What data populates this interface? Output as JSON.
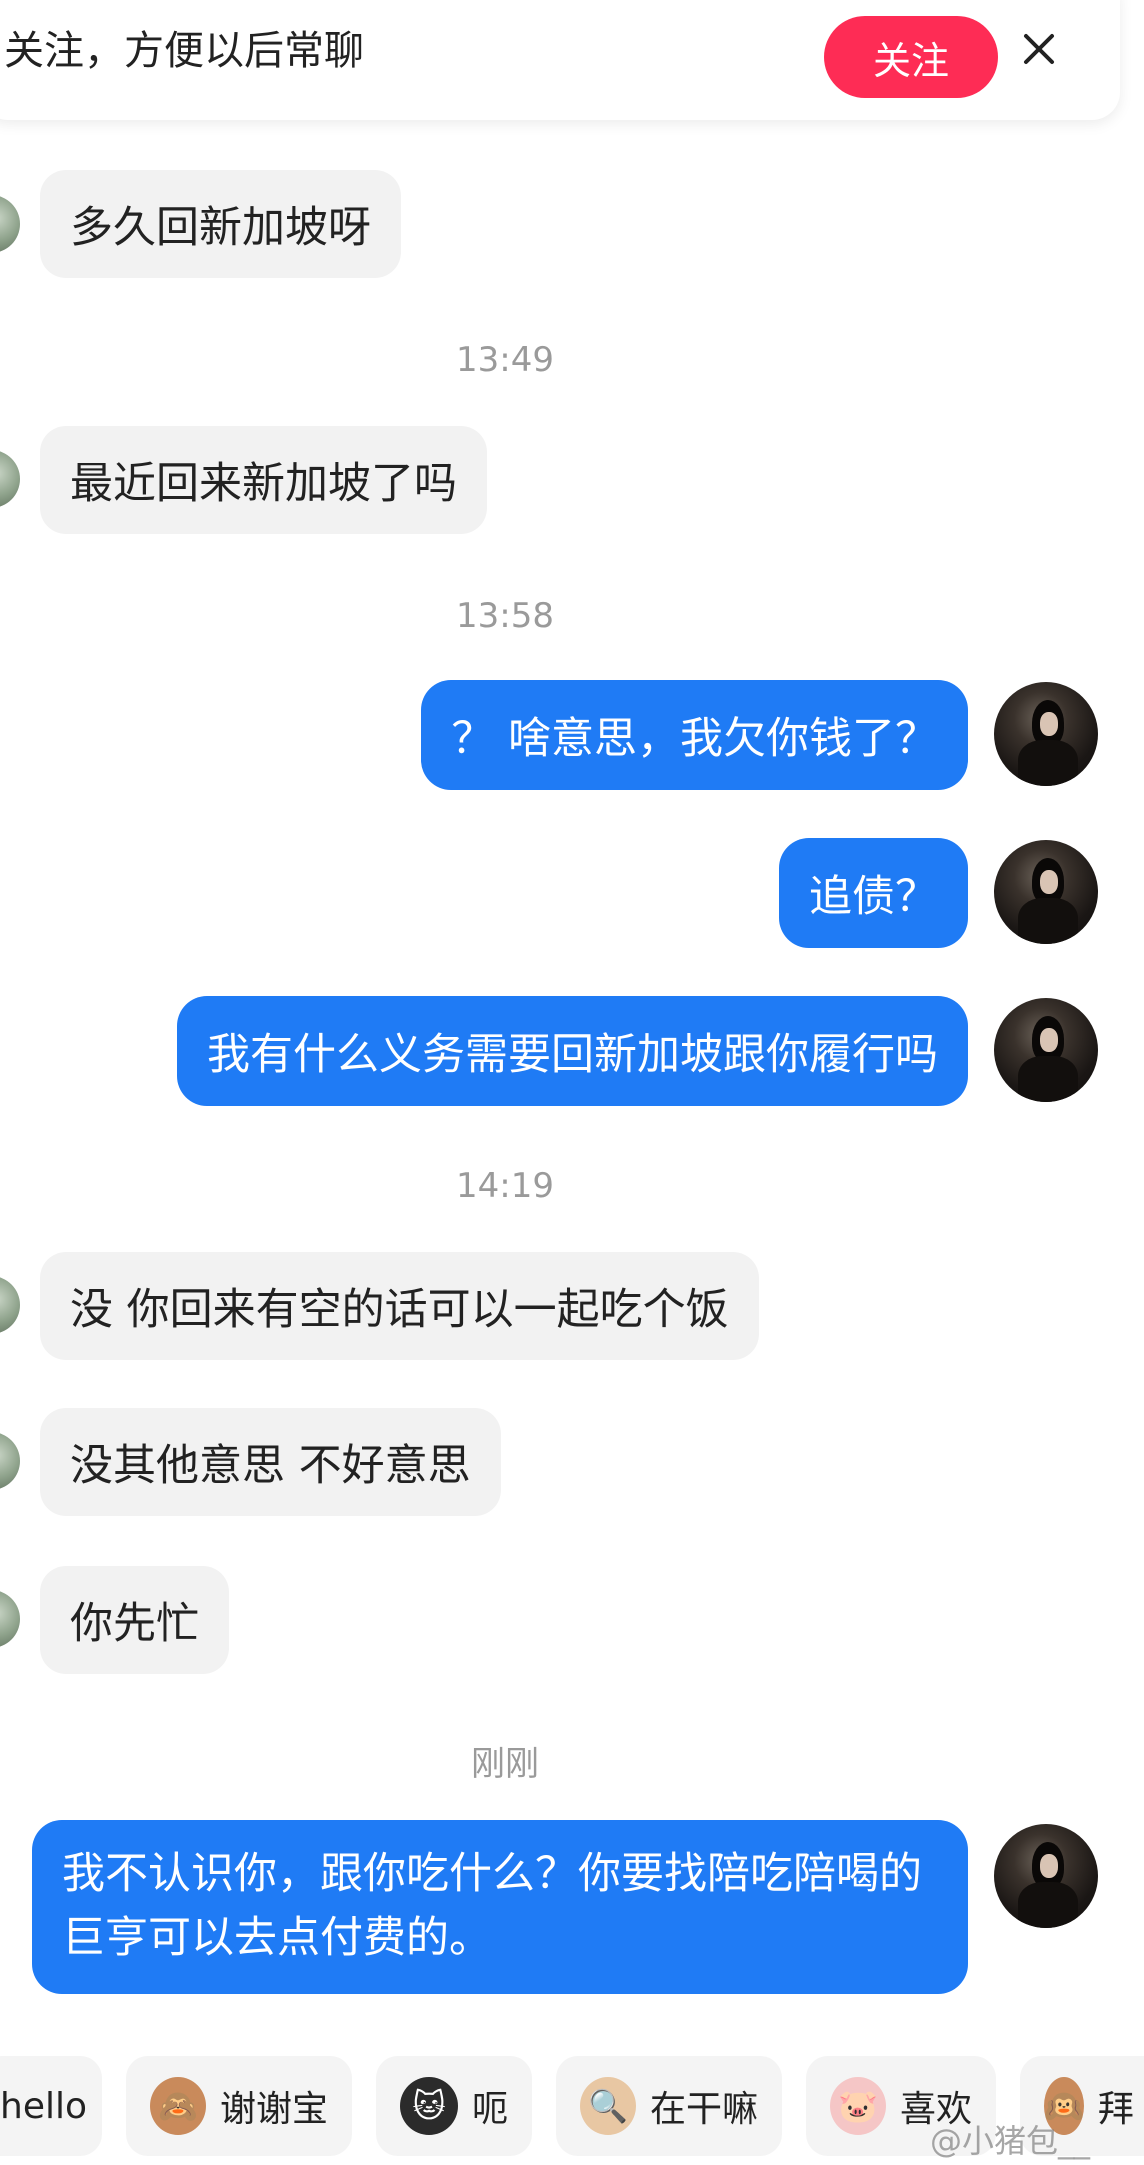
{
  "follow_banner": {
    "text": "关注，方便以后常聊",
    "button_label": "关注"
  },
  "timestamps": [
    "13:49",
    "13:58",
    "14:19",
    "刚刚"
  ],
  "messages": {
    "in_1": "多久回新加坡呀",
    "in_2": "最近回来新加坡了吗",
    "out_1": "？ 啥意思，我欠你钱了？",
    "out_2": "追债？",
    "out_3": "我有什么义务需要回新加坡跟你履行吗",
    "in_3": "没 你回来有空的话可以一起吃个饭",
    "in_4": "没其他意思 不好意思",
    "in_5": "你先忙",
    "out_4": "我不认识你，跟你吃什么？你要找陪吃陪喝的巨亨可以去点付费的。"
  },
  "quick_replies": [
    {
      "label": "hello",
      "icon": "wave-icon"
    },
    {
      "label": "谢谢宝",
      "icon": "monkey-thanks-icon"
    },
    {
      "label": "呃",
      "icon": "cat-icon"
    },
    {
      "label": "在干嘛",
      "icon": "monkey-magnifier-icon"
    },
    {
      "label": "喜欢",
      "icon": "pig-icon"
    },
    {
      "label": "拜",
      "icon": "monkey-bye-icon"
    }
  ],
  "watermark": "@小猪包__",
  "colors": {
    "accent_red": "#fe2c55",
    "outgoing_bubble": "#1f7bf5",
    "incoming_bubble": "#f2f2f2"
  }
}
